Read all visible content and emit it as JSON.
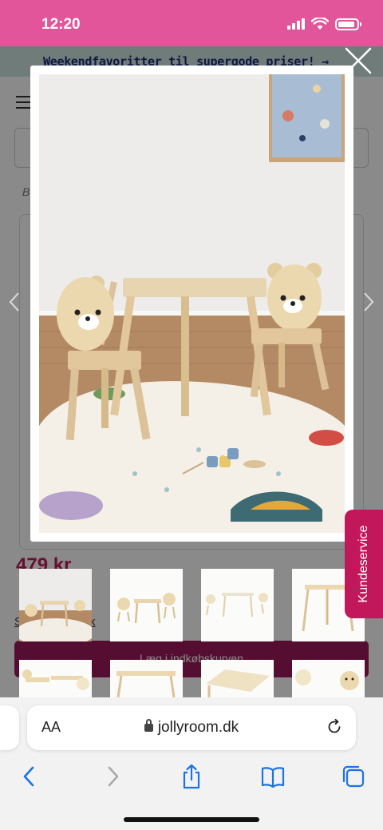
{
  "status_bar": {
    "time": "12:20"
  },
  "page": {
    "promo_text": "Weekendfavoritter til supergode priser! →",
    "breadcrumb": "B",
    "price": "479 kr",
    "cart_button": "Læg i indkøbskurven",
    "link_fragment": "S",
    "link_fragment_end": "k"
  },
  "gallery": {
    "main_image": "Kids wooden table with two bear chairs on a rug",
    "thumbnails": [
      "table-and-chairs-room",
      "table-and-bear-chairs",
      "table-and-chairs-white",
      "table-only",
      "bear-chair",
      "table-top",
      "table-side",
      "two-bear-chairs"
    ]
  },
  "customer_service": {
    "label": "Kundeservice"
  },
  "browser": {
    "text_size_label": "AA",
    "url": "jollyroom.dk"
  },
  "colors": {
    "brand_pink": "#e2559a",
    "brand_berry": "#c2185b",
    "browser_blue": "#1a73e8"
  }
}
